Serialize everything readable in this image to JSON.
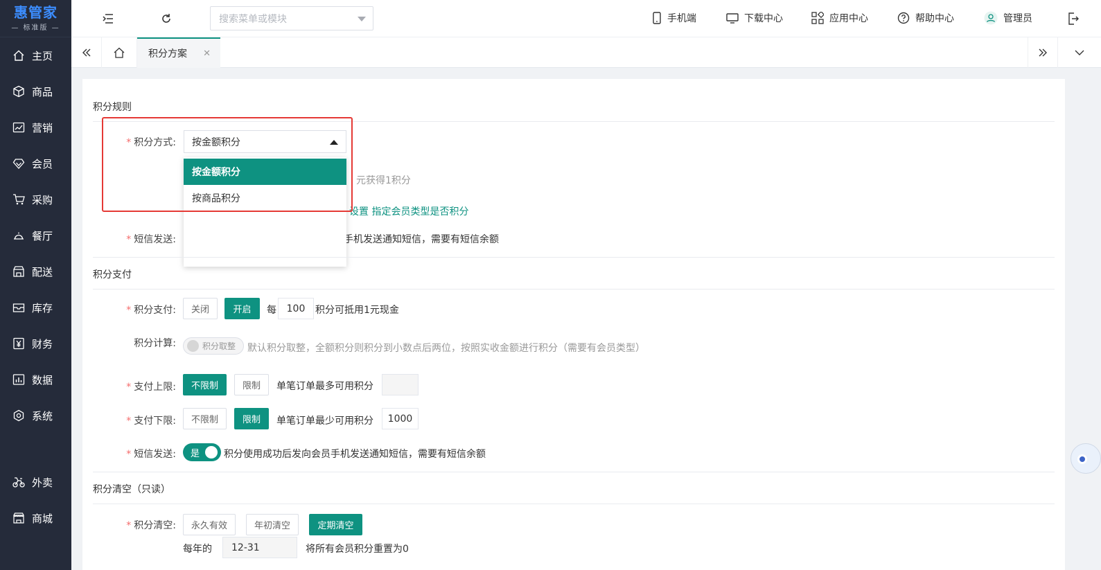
{
  "logo": {
    "main": "惠管家",
    "sub": "— 标准版 —"
  },
  "sidebar": {
    "items": [
      {
        "label": "主页",
        "icon": "home-icon"
      },
      {
        "label": "商品",
        "icon": "box-icon"
      },
      {
        "label": "营销",
        "icon": "chart-icon"
      },
      {
        "label": "会员",
        "icon": "diamond-icon"
      },
      {
        "label": "采购",
        "icon": "cart-icon"
      },
      {
        "label": "餐厅",
        "icon": "bell-icon"
      },
      {
        "label": "配送",
        "icon": "store-icon"
      },
      {
        "label": "库存",
        "icon": "inbox-icon"
      },
      {
        "label": "财务",
        "icon": "yen-icon"
      },
      {
        "label": "数据",
        "icon": "bar-chart-icon"
      },
      {
        "label": "系统",
        "icon": "settings-icon"
      },
      {
        "label": "外卖",
        "icon": "bike-icon"
      },
      {
        "label": "商城",
        "icon": "shop-icon"
      }
    ]
  },
  "topbar": {
    "search_placeholder": "搜索菜单或模块",
    "links": [
      "手机端",
      "下载中心",
      "应用中心",
      "帮助中心",
      "管理员"
    ]
  },
  "tabs": {
    "active": "积分方案"
  },
  "form": {
    "rules_title": "积分规则",
    "method_label": "积分方式:",
    "method_value": "按金额积分",
    "method_options": [
      "按金额积分",
      "按商品积分"
    ],
    "earn_hint": "元获得1积分",
    "member_link": "设置 指定会员类型是否积分",
    "sms_label": "短信发送:",
    "sms_hint": "手机发送通知短信，需要有短信余额",
    "pay_title": "积分支付",
    "pay_label": "积分支付:",
    "pay_off": "关闭",
    "pay_on": "开启",
    "pay_per": "每",
    "pay_points": "100",
    "pay_hint": "积分可抵用1元现金",
    "calc_label": "积分计算:",
    "calc_switch": "积分取整",
    "calc_hint": "默认积分取整，全额积分则积分到小数点后两位，按照实收金额进行积分（需要有会员类型）",
    "upper_label": "支付上限:",
    "upper_unlimited": "不限制",
    "upper_limit": "限制",
    "upper_hint": "单笔订单最多可用积分",
    "lower_label": "支付下限:",
    "lower_unlimited": "不限制",
    "lower_limit": "限制",
    "lower_hint": "单笔订单最少可用积分",
    "lower_value": "1000",
    "sms2_label": "短信发送:",
    "sms2_switch": "是",
    "sms2_hint": "积分使用成功后发向会员手机发送通知短信，需要有短信余额",
    "clear_title": "积分清空（只读）",
    "clear_label": "积分清空:",
    "clear_forever": "永久有效",
    "clear_yearstart": "年初清空",
    "clear_periodic": "定期清空",
    "clear_each_year": "每年的",
    "clear_date": "12-31",
    "clear_hint": "将所有会员积分重置为0"
  },
  "colors": {
    "accent": "#0e9281",
    "sidebar": "#252b3a",
    "required": "#f56c6c",
    "highlight_box": "#e53935"
  }
}
